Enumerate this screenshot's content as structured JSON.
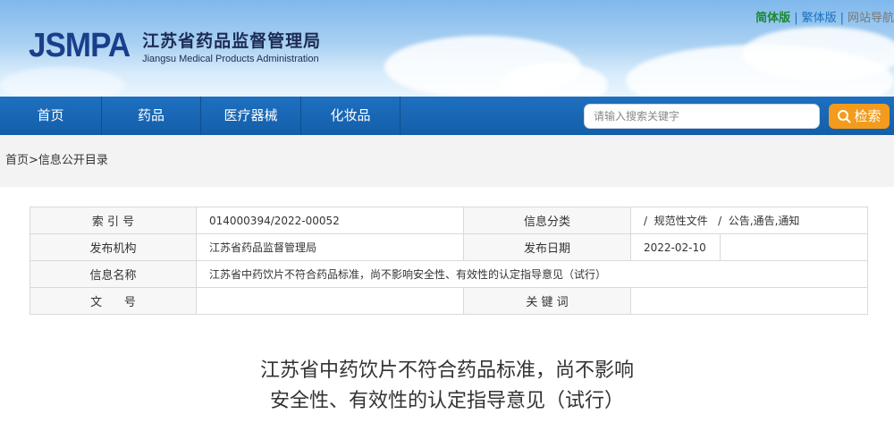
{
  "header": {
    "logo_text": "JSMPA",
    "org_cn": "江苏省药品监督管理局",
    "org_en": "Jiangsu Medical Products Administration",
    "top_links": [
      "简体版",
      "繁体版",
      "网站导航"
    ],
    "link_separator": "|"
  },
  "nav": {
    "items": [
      "首页",
      "药品",
      "医疗器械",
      "化妆品"
    ],
    "search_placeholder": "请输入搜索关键字",
    "search_button": "检索"
  },
  "breadcrumb": {
    "home": "首页",
    "separator": ">",
    "current": "信息公开目录"
  },
  "meta_table": {
    "index_label": "索 引 号",
    "index_value": "014000394/2022-00052",
    "category_label": "信息分类",
    "category_value": "/  规范性文件   /  公告,通告,通知",
    "publisher_label": "发布机构",
    "publisher_value": "江苏省药品监督管理局",
    "date_label": "发布日期",
    "date_value": "2022-02-10",
    "name_label": "信息名称",
    "name_value": "江苏省中药饮片不符合药品标准，尚不影响安全性、有效性的认定指导意见（试行）",
    "docno_label": "文      号",
    "docno_value": "",
    "keywords_label": "关 键 词",
    "keywords_value": ""
  },
  "article": {
    "title_line1": "江苏省中药饮片不符合药品标准，尚不影响",
    "title_line2": "安全性、有效性的认定指导意见（试行）"
  },
  "colors": {
    "nav_blue": "#1a67b5",
    "search_orange": "#f39b1c",
    "logo_blue": "#1a3f8a"
  }
}
